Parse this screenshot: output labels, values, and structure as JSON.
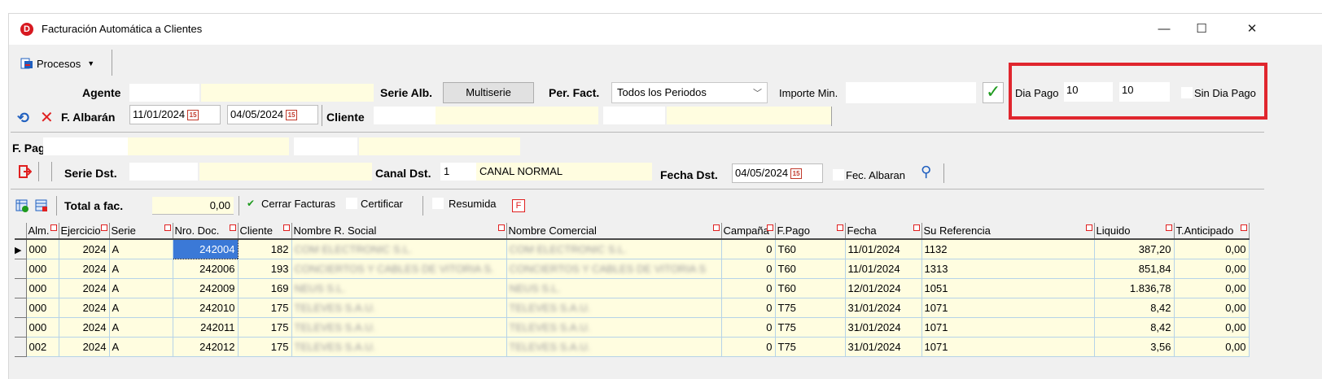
{
  "window": {
    "title": "Facturación Automática a Clientes",
    "minimize": "—",
    "maximize": "☐",
    "close": "✕"
  },
  "toolbar": {
    "procesos": "Procesos"
  },
  "filters": {
    "agente_label": "Agente",
    "serie_alb_label": "Serie Alb.",
    "multiserie_button": "Multiserie",
    "per_fact_label": "Per. Fact.",
    "per_fact_value": "Todos los Periodos",
    "importe_min_label": "Importe Min.",
    "dia_pago_label": "Dia Pago",
    "dia_pago_from": "10",
    "dia_pago_to": "10",
    "sin_dia_pago_label": "Sin Dia Pago",
    "f_albaran_label": "F. Albarán",
    "f_albaran_from": "11/01/2024",
    "f_albaran_to": "04/05/2024",
    "cliente_label": "Cliente",
    "f_pago_label": "F. Pago",
    "serie_dst_label": "Serie Dst.",
    "canal_dst_label": "Canal Dst.",
    "canal_dst_code": "1",
    "canal_dst_name": "CANAL NORMAL",
    "fecha_dst_label": "Fecha Dst.",
    "fecha_dst_value": "04/05/2024",
    "fec_albaran_label": "Fec. Albaran"
  },
  "totals": {
    "total_label": "Total a fac.",
    "total_value": "0,00",
    "cerrar_facturas": "Cerrar Facturas",
    "certificar": "Certificar",
    "resumida": "Resumida"
  },
  "columns": [
    "Alm.",
    "Ejercicio",
    "Serie",
    "Nro. Doc.",
    "Cliente",
    "Nombre R. Social",
    "Nombre Comercial",
    "Campaña",
    "F.Pago",
    "Fecha",
    "Su Referencia",
    "Liquido",
    "T.Anticipado"
  ],
  "rows": [
    {
      "alm": "000",
      "ejercicio": "2024",
      "serie": "A",
      "nro": "242004",
      "cliente": "182",
      "social": "COM ELECTRONIC S.L.",
      "comercial": "COM ELECTRONIC S.L.",
      "campana": "0",
      "fpago": "T60",
      "fecha": "11/01/2024",
      "ref": "1132",
      "liquido": "387,20",
      "anticipado": "0,00"
    },
    {
      "alm": "000",
      "ejercicio": "2024",
      "serie": "A",
      "nro": "242006",
      "cliente": "193",
      "social": "CONCIERTOS Y CABLES DE VITORIA S.",
      "comercial": "CONCIERTOS Y CABLES DE VITORIA S",
      "campana": "0",
      "fpago": "T60",
      "fecha": "11/01/2024",
      "ref": "1313",
      "liquido": "851,84",
      "anticipado": "0,00"
    },
    {
      "alm": "000",
      "ejercicio": "2024",
      "serie": "A",
      "nro": "242009",
      "cliente": "169",
      "social": "NEUS S.L.",
      "comercial": "NEUS S.L.",
      "campana": "0",
      "fpago": "T60",
      "fecha": "12/01/2024",
      "ref": "1051",
      "liquido": "1.836,78",
      "anticipado": "0,00"
    },
    {
      "alm": "000",
      "ejercicio": "2024",
      "serie": "A",
      "nro": "242010",
      "cliente": "175",
      "social": "TELEVES S.A.U.",
      "comercial": "TELEVES S.A.U.",
      "campana": "0",
      "fpago": "T75",
      "fecha": "31/01/2024",
      "ref": "1071",
      "liquido": "8,42",
      "anticipado": "0,00"
    },
    {
      "alm": "000",
      "ejercicio": "2024",
      "serie": "A",
      "nro": "242011",
      "cliente": "175",
      "social": "TELEVES S.A.U.",
      "comercial": "TELEVES S.A.U.",
      "campana": "0",
      "fpago": "T75",
      "fecha": "31/01/2024",
      "ref": "1071",
      "liquido": "8,42",
      "anticipado": "0,00"
    },
    {
      "alm": "002",
      "ejercicio": "2024",
      "serie": "A",
      "nro": "242012",
      "cliente": "175",
      "social": "TELEVES S.A.U.",
      "comercial": "TELEVES S.A.U.",
      "campana": "0",
      "fpago": "T75",
      "fecha": "31/01/2024",
      "ref": "1071",
      "liquido": "3,56",
      "anticipado": "0,00"
    }
  ]
}
